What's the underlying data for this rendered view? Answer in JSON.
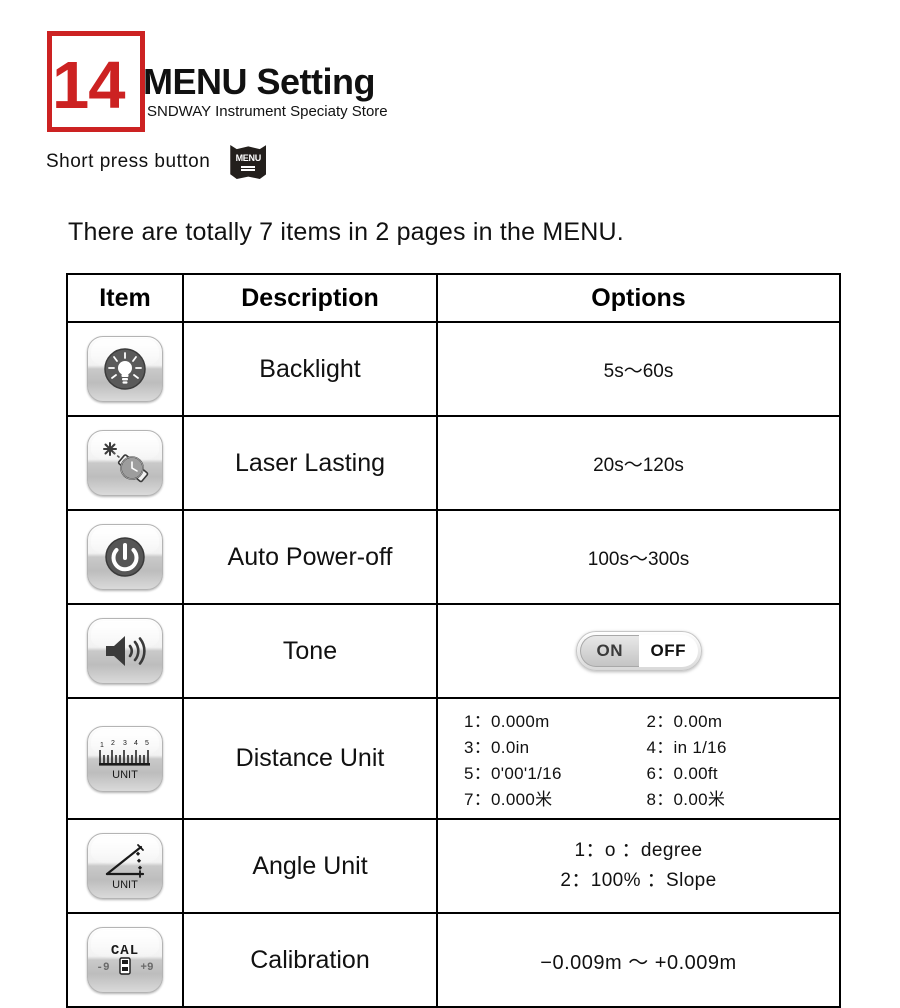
{
  "header": {
    "badge_number": "14",
    "title": "MENU Setting",
    "subtitle": "SNDWAY Instrument Speciaty Store",
    "press_label": "Short press button",
    "menu_key_label": "MENU",
    "menu_key_icon": "menu-bars-icon",
    "badge_color": "#cc2222"
  },
  "intro": "There are totally 7 items in 2 pages in the MENU.",
  "table": {
    "columns": [
      "Item",
      "Description",
      "Options"
    ],
    "rows": [
      {
        "icon": "backlight-bulb-icon",
        "description": "Backlight",
        "option_type": "text",
        "option_text": "5s～60s"
      },
      {
        "icon": "laser-beam-icon",
        "description": "Laser Lasting",
        "option_type": "text",
        "option_text": "20s～120s"
      },
      {
        "icon": "power-off-icon",
        "description": "Auto Power-off",
        "option_type": "text",
        "option_text": "100s～300s"
      },
      {
        "icon": "speaker-tone-icon",
        "description": "Tone",
        "option_type": "toggle",
        "toggle": {
          "on_label": "ON",
          "off_label": "OFF",
          "selected": "OFF"
        }
      },
      {
        "icon": "ruler-unit-icon",
        "description": "Distance Unit",
        "option_type": "unit-grid",
        "units": [
          "1：0.000m",
          "2：0.00m",
          "3：0.0in",
          "4：in 1/16",
          "5：0'00'1/16",
          "6：0.00ft",
          "7：0.000米",
          "8：0.00米"
        ]
      },
      {
        "icon": "angle-unit-icon",
        "description": "Angle Unit",
        "option_type": "angle-list",
        "angles": [
          "1：o ：degree",
          "2：100% ：Slope"
        ]
      },
      {
        "icon": "calibration-cal-icon",
        "description": "Calibration",
        "option_type": "text",
        "option_text": "−0.009m ～ +0.009m"
      }
    ]
  },
  "icon_labels": {
    "ruler_numbers": [
      "1",
      "2",
      "3",
      "4",
      "5"
    ],
    "unit_text": "UNIT",
    "cal_text": "CAL",
    "cal_minus": "-9",
    "cal_plus": "+9"
  }
}
